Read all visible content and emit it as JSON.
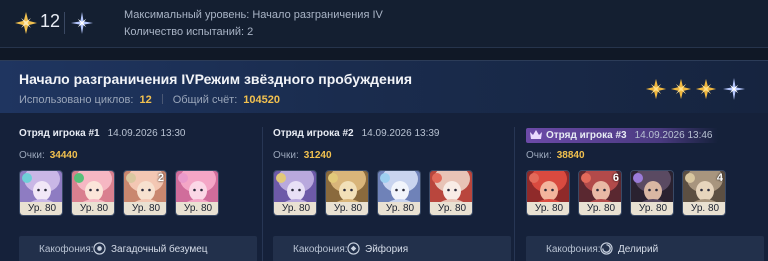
{
  "summary": {
    "star_count": "12",
    "max_level_text": "Максимальный уровень: Начало разграничения IV",
    "attempts_text": "Количество испытаний: 2"
  },
  "card": {
    "title": "Начало разграничения IVРежим звёздного пробуждения",
    "cycles_label": "Использовано циклов:",
    "cycles_value": "12",
    "total_label": "Общий счёт:",
    "total_value": "104520",
    "stars_earned": 3
  },
  "teams": [
    {
      "name": "Отряд игрока #1",
      "date": "14.09.2026 13:30",
      "score_label": "Очки:",
      "score": "34440",
      "crowned": false,
      "characters": [
        {
          "level": "Ур. 80",
          "eidolon": "",
          "element_color": "#6fd0d8",
          "palette": [
            "#c9b7e6",
            "#8e7cc2",
            "#f1e7f7"
          ]
        },
        {
          "level": "Ур. 80",
          "eidolon": "",
          "element_color": "#57c07a",
          "palette": [
            "#f6b7c3",
            "#d9808f",
            "#fbe5d9"
          ]
        },
        {
          "level": "Ур. 80",
          "eidolon": "2",
          "element_color": "#d9c7a0",
          "palette": [
            "#f3c7b3",
            "#c9876f",
            "#f7e1cf"
          ]
        },
        {
          "level": "Ур. 80",
          "eidolon": "",
          "element_color": "#e99acb",
          "palette": [
            "#f4a6c6",
            "#d06d9b",
            "#fbd7e6"
          ]
        }
      ],
      "cacophony_label": "Какофония:",
      "cacophony": "Загадочный безумец"
    },
    {
      "name": "Отряд игрока #2",
      "date": "14.09.2026 13:39",
      "score_label": "Очки:",
      "score": "31240",
      "crowned": false,
      "characters": [
        {
          "level": "Ур. 80",
          "eidolon": "",
          "element_color": "#e2c97a",
          "palette": [
            "#b9a9dd",
            "#6d5aa8",
            "#e8e0f6"
          ]
        },
        {
          "level": "Ур. 80",
          "eidolon": "",
          "element_color": "#e2c97a",
          "palette": [
            "#d9b57a",
            "#8a6a3d",
            "#f2e0b8"
          ]
        },
        {
          "level": "Ур. 80",
          "eidolon": "",
          "element_color": "#9ed0f0",
          "palette": [
            "#c9d4ef",
            "#6f82b8",
            "#f1f4fb"
          ]
        },
        {
          "level": "Ур. 80",
          "eidolon": "",
          "element_color": "#e26a5a",
          "palette": [
            "#e8c3b6",
            "#b9463d",
            "#f8ece6"
          ]
        }
      ],
      "cacophony_label": "Какофония:",
      "cacophony": "Эйфория"
    },
    {
      "name": "Отряд игрока #3",
      "date": "14.09.2026 13:46",
      "score_label": "Очки:",
      "score": "38840",
      "crowned": true,
      "characters": [
        {
          "level": "Ур. 80",
          "eidolon": "",
          "element_color": "#e26a5a",
          "palette": [
            "#d94a3f",
            "#8f2a2a",
            "#f3b49d"
          ]
        },
        {
          "level": "Ур. 80",
          "eidolon": "6",
          "element_color": "#e26a5a",
          "palette": [
            "#b24a4a",
            "#5a2830",
            "#e9b9a5"
          ]
        },
        {
          "level": "Ур. 80",
          "eidolon": "",
          "element_color": "#9b7bd8",
          "palette": [
            "#5a4a62",
            "#2a2230",
            "#d9b7a3"
          ]
        },
        {
          "level": "Ур. 80",
          "eidolon": "4",
          "element_color": "#d9c7a0",
          "palette": [
            "#a8957e",
            "#5c4f42",
            "#e7d5bd"
          ]
        }
      ],
      "cacophony_label": "Какофония:",
      "cacophony": "Делирий"
    }
  ],
  "colors": {
    "accent_gold": "#f2c14f",
    "background": "#101826",
    "card": "#15213a",
    "crown_badge": "#6c4aa8"
  }
}
